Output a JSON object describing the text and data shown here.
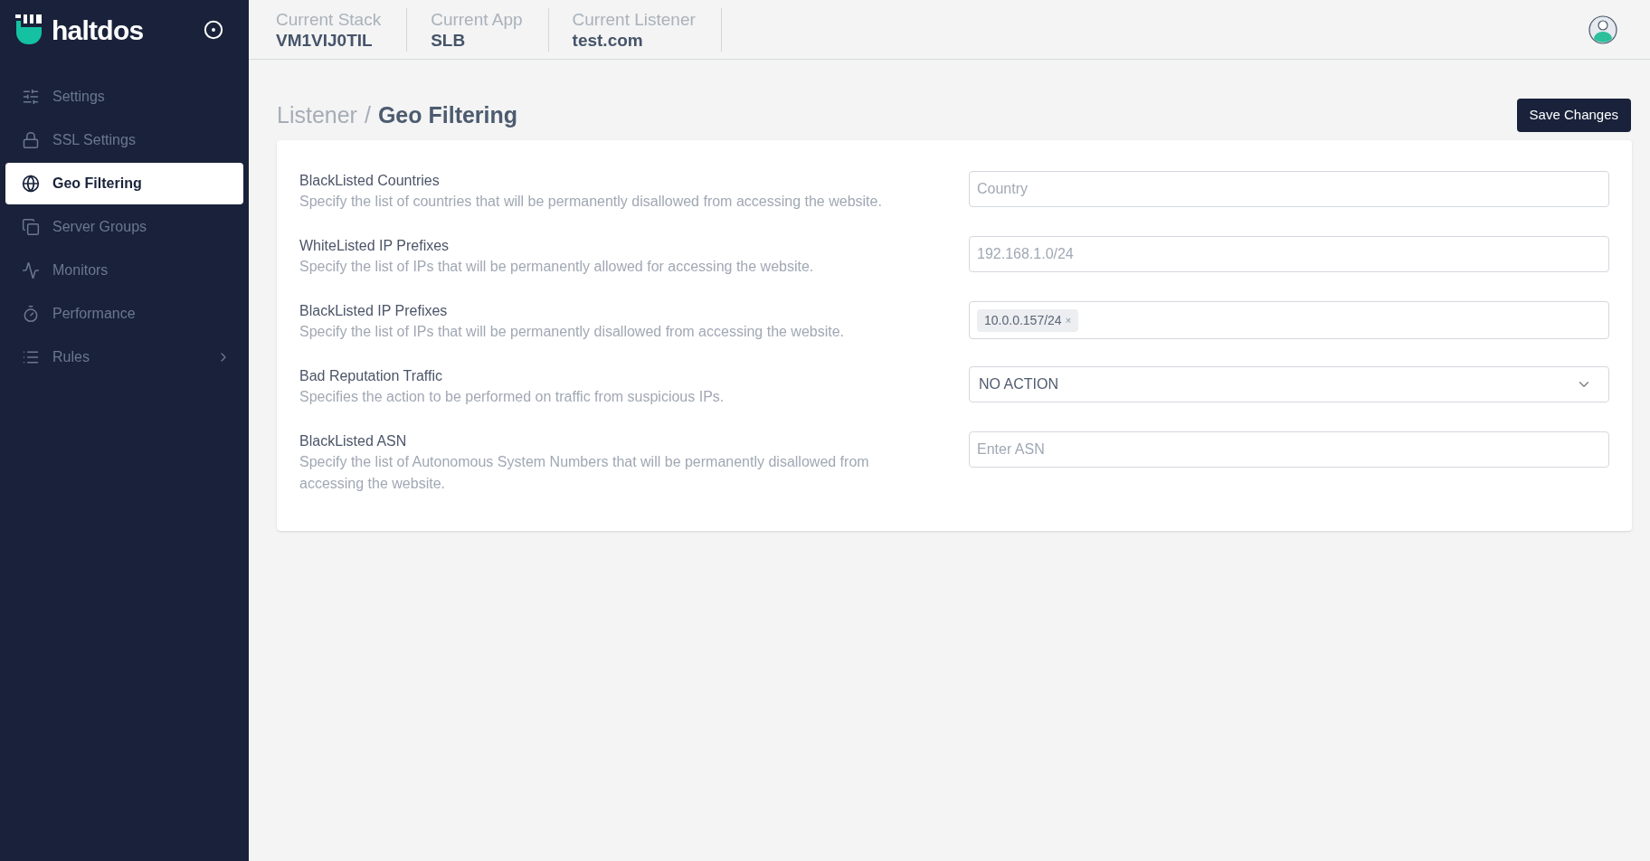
{
  "brand": {
    "name": "haltdos"
  },
  "sidebar": {
    "items": [
      {
        "label": "Settings",
        "selected": false,
        "expandable": false
      },
      {
        "label": "SSL Settings",
        "selected": false,
        "expandable": false
      },
      {
        "label": "Geo Filtering",
        "selected": true,
        "expandable": false
      },
      {
        "label": "Server Groups",
        "selected": false,
        "expandable": false
      },
      {
        "label": "Monitors",
        "selected": false,
        "expandable": false
      },
      {
        "label": "Performance",
        "selected": false,
        "expandable": false
      },
      {
        "label": "Rules",
        "selected": false,
        "expandable": true
      }
    ]
  },
  "header": {
    "context": [
      {
        "label": "Current Stack",
        "value": "VM1VIJ0TIL"
      },
      {
        "label": "Current App",
        "value": "SLB"
      },
      {
        "label": "Current Listener",
        "value": "test.com"
      }
    ]
  },
  "page": {
    "breadcrumb": "Listener",
    "separator": "/",
    "title": "Geo Filtering",
    "save_button": "Save Changes"
  },
  "form": {
    "rows": [
      {
        "label": "BlackListed Countries",
        "description": "Specify the list of countries that will be permanently disallowed from accessing the website.",
        "kind": "text",
        "placeholder": "Country"
      },
      {
        "label": "WhiteListed IP Prefixes",
        "description": "Specify the list of IPs that will be permanently allowed for accessing the website.",
        "kind": "text",
        "placeholder": "192.168.1.0/24"
      },
      {
        "label": "BlackListed IP Prefixes",
        "description": "Specify the list of IPs that will be permanently disallowed from accessing the website.",
        "kind": "tags",
        "tags": [
          {
            "text": "10.0.0.157/24",
            "remove": "×"
          }
        ]
      },
      {
        "label": "Bad Reputation Traffic",
        "description": "Specifies the action to be performed on traffic from suspicious IPs.",
        "kind": "select",
        "value": "NO ACTION"
      },
      {
        "label": "BlackListed ASN",
        "description": "Specify the list of Autonomous System Numbers that will be permanently disallowed from accessing the website.",
        "kind": "text",
        "placeholder": "Enter ASN"
      }
    ]
  }
}
